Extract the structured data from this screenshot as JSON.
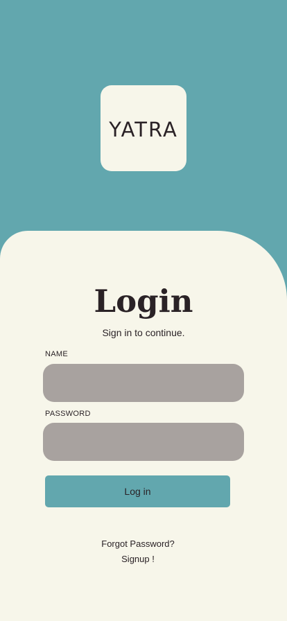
{
  "logo": {
    "text": "YATRA"
  },
  "login": {
    "title": "Login",
    "subtitle": "Sign in to continue.",
    "name_label": "NAME",
    "name_value": "",
    "name_placeholder": "",
    "password_label": "PASSWORD",
    "password_value": "",
    "password_placeholder": "",
    "button_label": "Log in"
  },
  "links": {
    "forgot_password": "Forgot Password?",
    "signup": "Signup !"
  },
  "colors": {
    "accent": "#62a7ae",
    "background": "#f7f6ea",
    "input_fill": "#a8a29f",
    "text": "#2a2226"
  }
}
